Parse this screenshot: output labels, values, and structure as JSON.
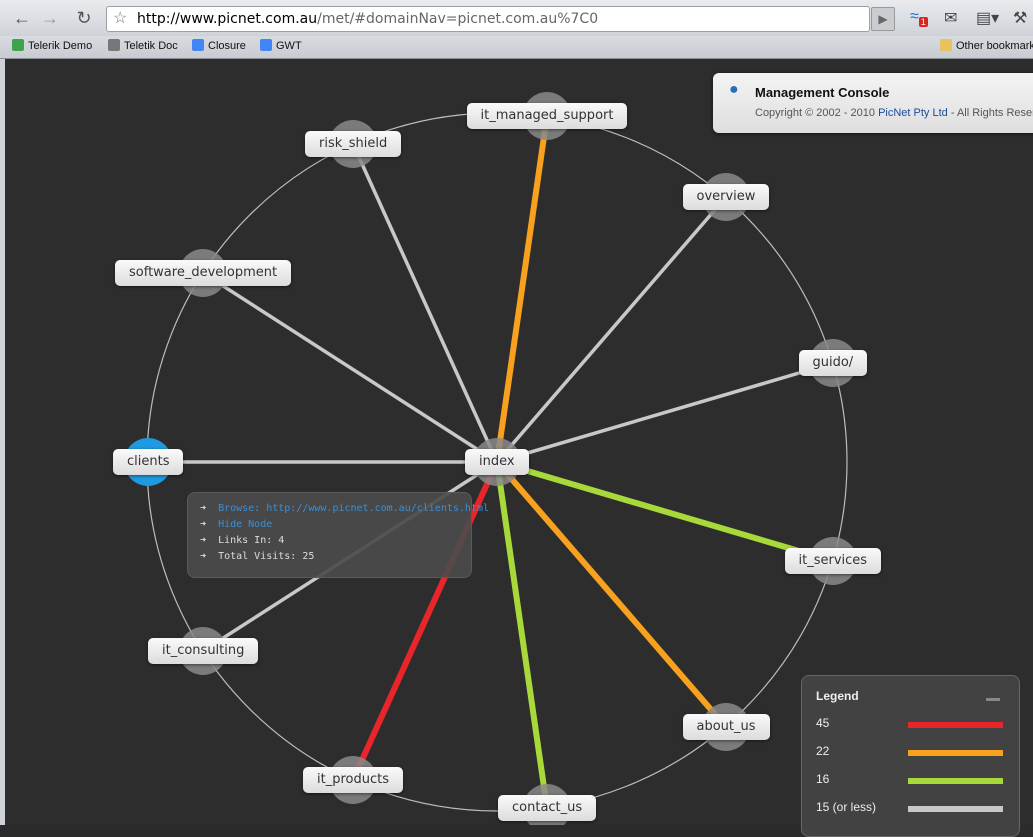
{
  "browser": {
    "url_host": "http://www.picnet.com.au",
    "url_path": "/met/#domainNav=picnet.com.au%7C0",
    "bookmarks": [
      {
        "label": "Telerik Demo",
        "color": "#3fa34d"
      },
      {
        "label": "Teletik Doc",
        "color": "#777777"
      },
      {
        "label": "Closure",
        "color": "#4285f4"
      },
      {
        "label": "GWT",
        "color": "#4285f4"
      }
    ],
    "other_bookmarks": "Other bookmarks",
    "rss_badge": "1"
  },
  "console": {
    "title": "Management Console",
    "copyright_prefix": "Copyright © 2002 - 2010 ",
    "company": "PicNet Pty Ltd",
    "copyright_suffix": " - All Rights Reserved"
  },
  "graph": {
    "center": "index",
    "nodes": [
      {
        "id": "it_managed_support",
        "visits": 22
      },
      {
        "id": "overview",
        "visits": 15
      },
      {
        "id": "guido/",
        "visits": 15
      },
      {
        "id": "it_services",
        "visits": 16
      },
      {
        "id": "about_us",
        "visits": 22
      },
      {
        "id": "contact_us",
        "visits": 16
      },
      {
        "id": "it_products",
        "visits": 45
      },
      {
        "id": "it_consulting",
        "visits": 15
      },
      {
        "id": "clients",
        "visits": 15,
        "selected": true
      },
      {
        "id": "software_development",
        "visits": 15
      },
      {
        "id": "risk_shield",
        "visits": 15
      }
    ]
  },
  "tooltip": {
    "browse": "Browse: http://www.picnet.com.au/clients.html",
    "hide": "Hide Node",
    "links_in": "Links In: 4",
    "total_visits": "Total Visits: 25"
  },
  "legend": {
    "title": "Legend",
    "items": [
      {
        "label": "45",
        "color": "#e8262a"
      },
      {
        "label": "22",
        "color": "#f8a11e"
      },
      {
        "label": "16",
        "color": "#a8d93a"
      },
      {
        "label": "15 (or less)",
        "color": "#c8c8c8"
      }
    ]
  },
  "colors": {
    "ring": "#bdbdbd",
    "selected": "#1e9be0",
    "node_halo": "#8a8a8a"
  }
}
